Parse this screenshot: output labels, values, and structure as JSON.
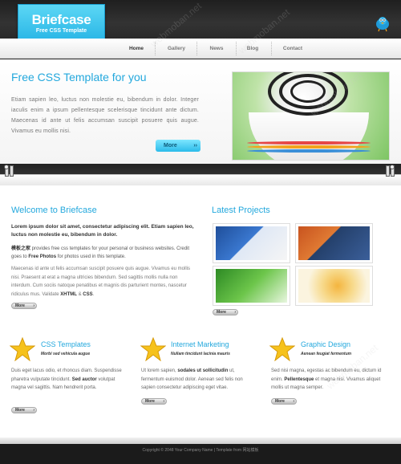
{
  "brand": {
    "title": "Briefcase",
    "tagline": "Free CSS Template"
  },
  "nav": {
    "items": [
      "Home",
      "Gallery",
      "News",
      "Blog",
      "Contact"
    ]
  },
  "hero": {
    "title": "Free CSS Template for you",
    "text": "Etiam sapien leo, luctus non molestie eu, bibendum in dolor. Integer iaculis enim a ipsum pellentesque scelerisque tincidunt ante dictum. Maecenas id ante ut felis accumsan suscipit posuere quis augue. Vivamus eu mollis nisi.",
    "more_label": "More",
    "more_arrow": "››"
  },
  "welcome": {
    "title": "Welcome to Briefcase",
    "bold_intro": "Lorem ipsum dolor sit amet, consectetur adipiscing elit. Etiam sapien leo, luctus non molestie eu, bibendum in dolor.",
    "p2_prefix": "模板之家",
    "p2_mid": " provides free css templates for your personal or business websites. Credit goes to ",
    "p2_bold": "Free Photos",
    "p2_suffix": " for photos used in this template.",
    "p3_text": "Maecenas id ante ut felis accumsan suscipit posuere quis augue. Vivamus eu mollis nisi. Praesent at erat a magna ultricies bibendum. Sed sagittis mollis nulla non interdum. Cum sociis natoque penatibus et magnis dis parturient montes, nascetur ridiculus mus. Validate ",
    "p3_bold1": "XHTML",
    "p3_and": " & ",
    "p3_bold2": "CSS",
    "p3_end": ".",
    "more_label": "More"
  },
  "projects": {
    "title": "Latest Projects",
    "more_label": "More"
  },
  "columns": [
    {
      "title": "CSS Templates",
      "subtitle": "Morbi sed vehicula augue",
      "text_a": "Duis eget lacus odio, et rhoncus diam. Suspendisse pharetra vulputate tincidunt. ",
      "text_bold": "Sed auctor",
      "text_b": " volutpat magna vel sagittis. Nam hendrerit porta.",
      "more_label": "More"
    },
    {
      "title": "Internet Marketing",
      "subtitle": "Nullam tincidunt lacinia mauris",
      "text_a": "Ut lorem sapien, ",
      "text_bold": "sodales ut sollicitudin",
      "text_b": " ut, fermentum euismod dolor. Aenean sed felis non sapien consectetur adipiscing eget vitae.",
      "more_label": "More"
    },
    {
      "title": "Graphic Design",
      "subtitle": "Aenean feugiat fermentum",
      "text_a": "Sed nisi magna, egestas ac bibendum eu, dictum id enim. ",
      "text_bold": "Pellentesque",
      "text_b": " et magna nisi. Vivamus aliquet mollis ut magna semper.",
      "more_label": "More"
    }
  ],
  "footer": {
    "text": "Copyright © 2048 Your Company Name | Template from 网站模板"
  },
  "watermark": {
    "text": "webmoban.net"
  },
  "colors": {
    "accent": "#23a8dd",
    "logo": "#2bb5e6",
    "dark": "#2b2b2b"
  }
}
